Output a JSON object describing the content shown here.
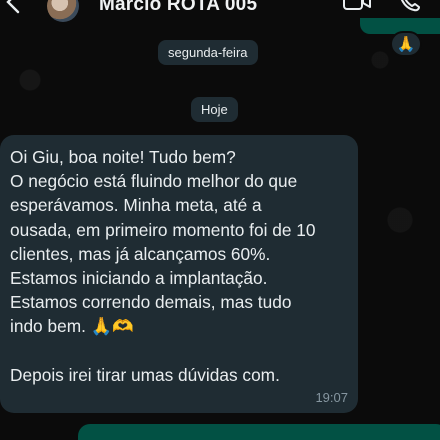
{
  "header": {
    "contact_name": "Marcio ROTA 005"
  },
  "chat": {
    "date_divider_1": "segunda-feira",
    "date_divider_2": "Hoje",
    "reaction_emoji": "🙏",
    "message": {
      "text": "Oi Giu, boa noite! Tudo bem?\nO negócio está fluindo melhor do que\nesperávamos. Minha meta, até a\nousada, em primeiro momento foi de 10\nclientes, mas já alcançamos 60%.\nEstamos iniciando a implantação.\nEstamos correndo demais, mas tudo\nindo bem. 🙏🫶\n\nDepois irei tirar umas dúvidas com.",
      "time": "19:07"
    }
  },
  "colors": {
    "background": "#0b0b0b",
    "incoming_bubble": "#1f2c33",
    "outgoing_bubble": "#025144",
    "timestamp": "#8696a0"
  }
}
